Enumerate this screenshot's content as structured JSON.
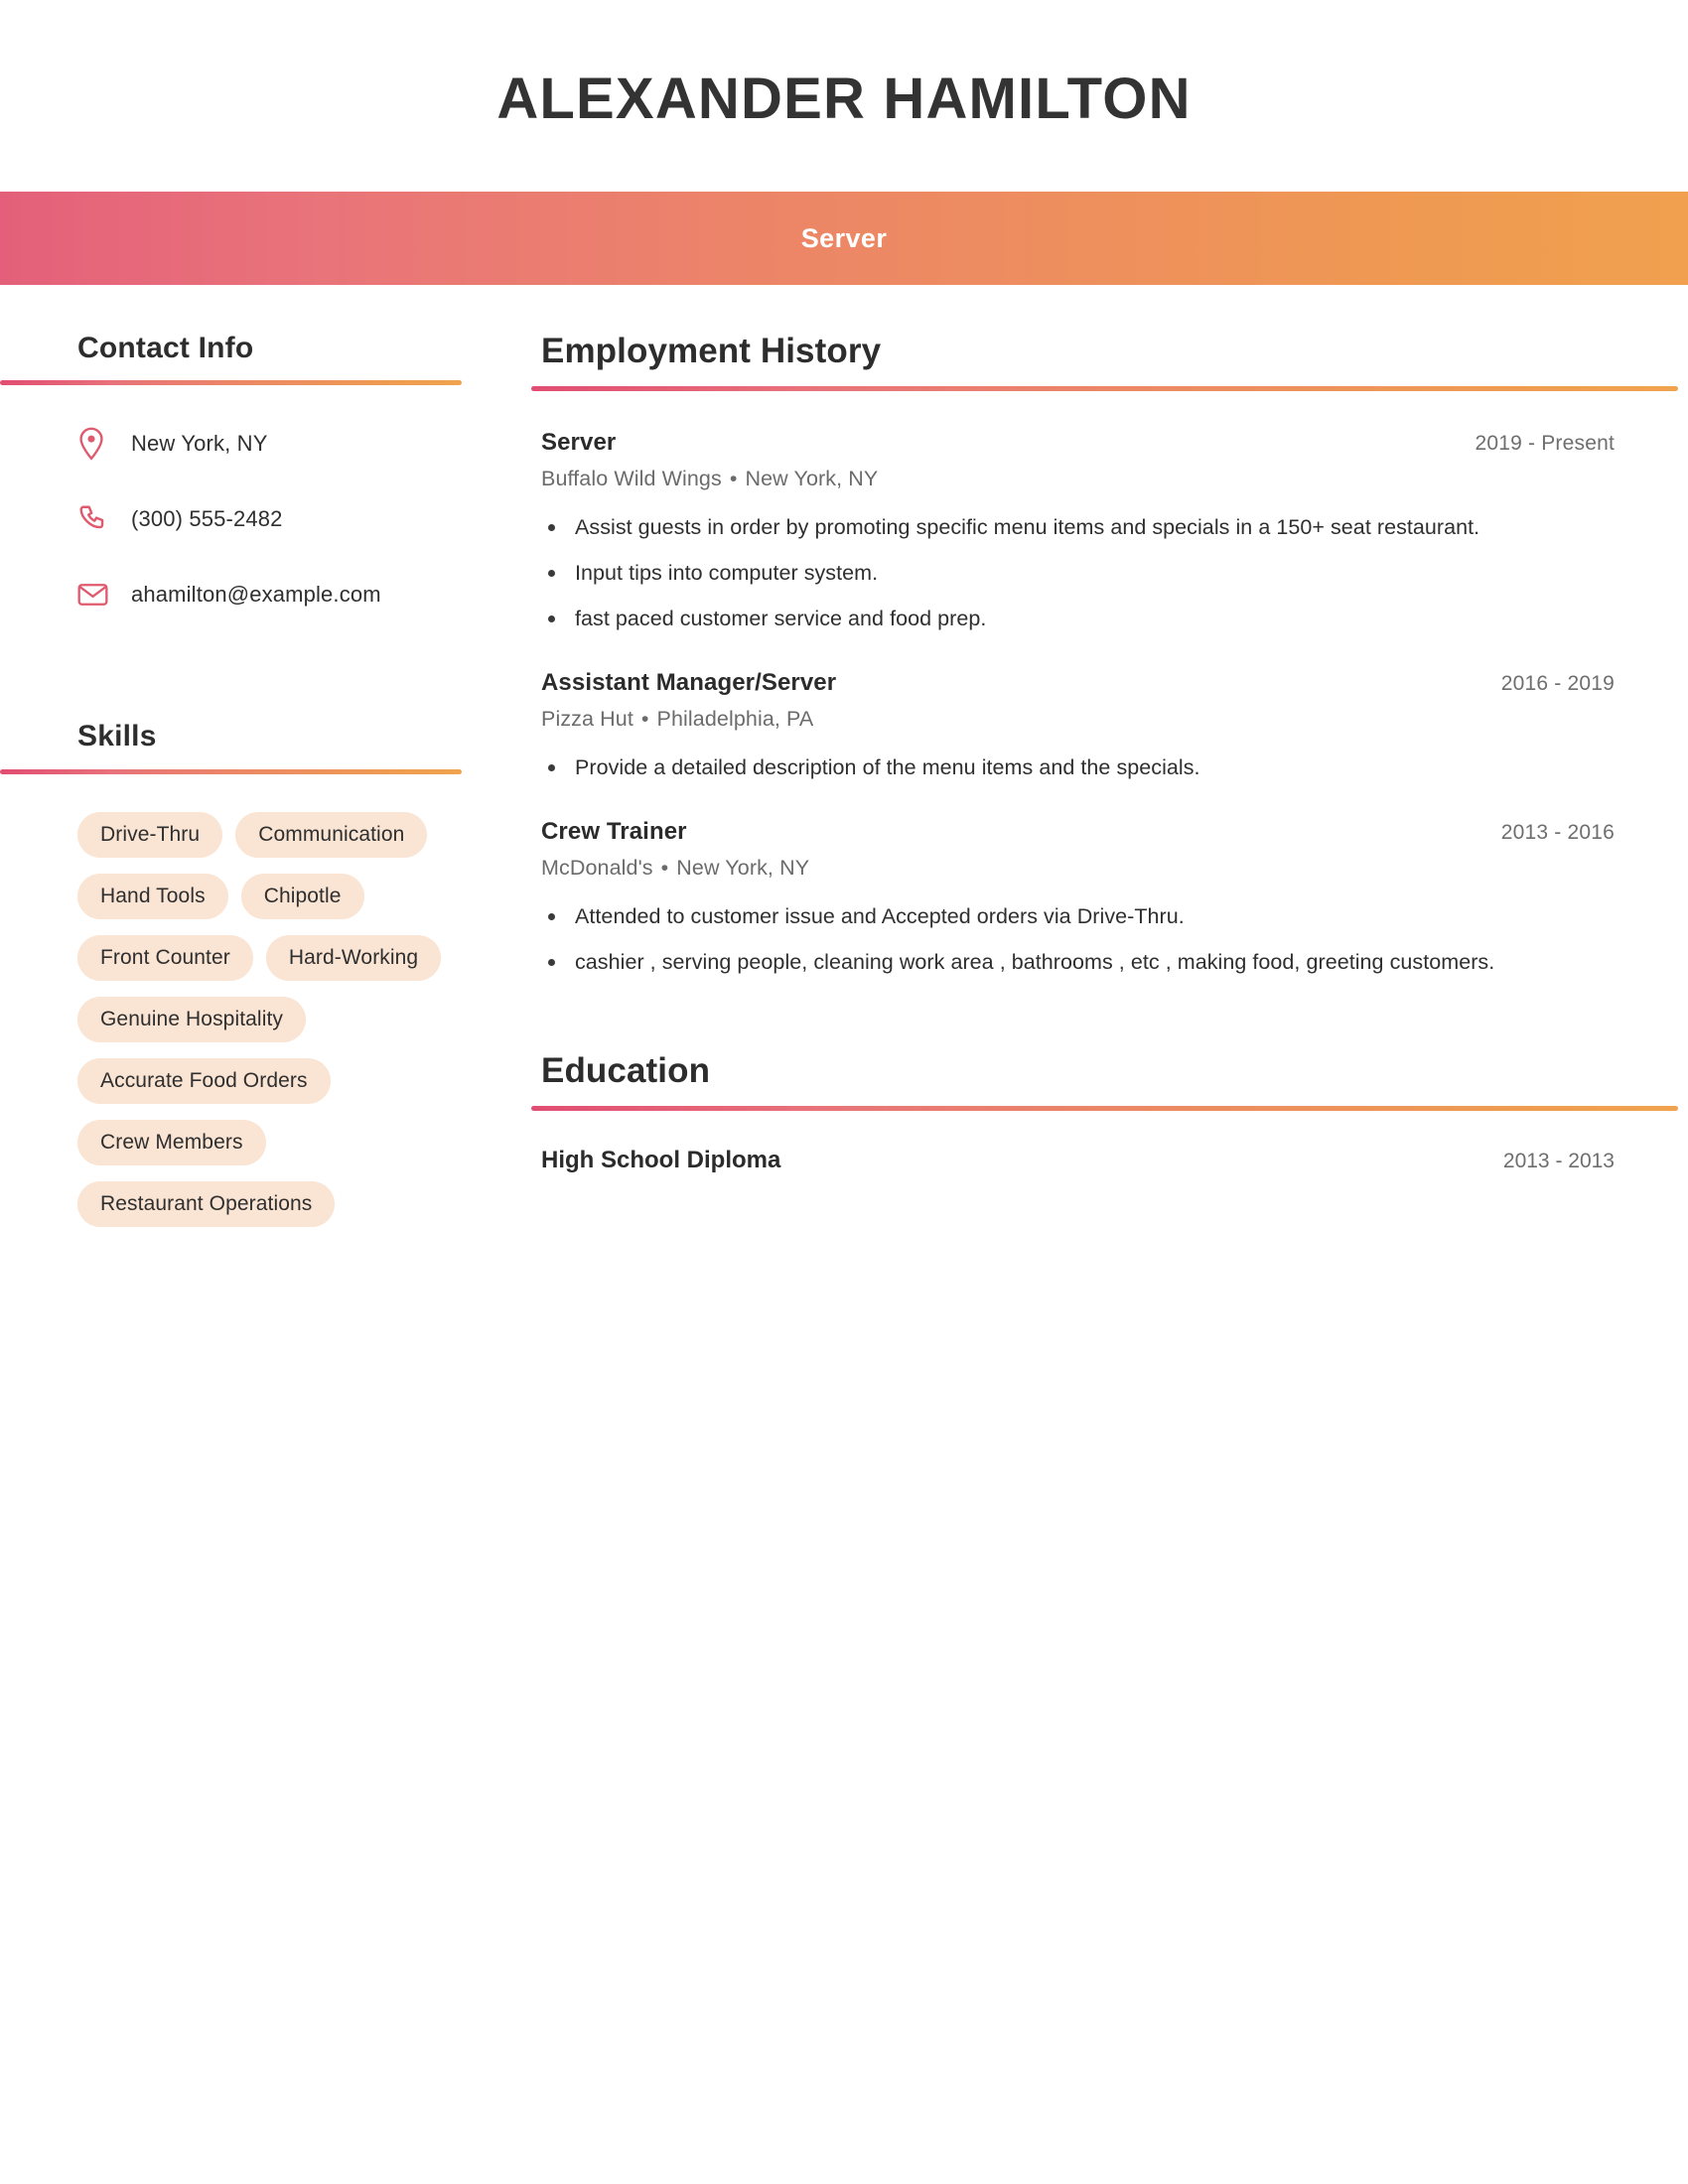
{
  "header": {
    "name": "ALEXANDER HAMILTON",
    "title": "Server"
  },
  "colors": {
    "gradient_start": "#e4607a",
    "gradient_end": "#f0a04f",
    "icon_pink": "#e05a6e",
    "skill_pill_bg": "#fae4d3",
    "heading_text": "#2d2d2d",
    "muted_text": "#6e6e6e"
  },
  "sidebar": {
    "contact": {
      "heading": "Contact Info",
      "items": [
        {
          "icon": "location-pin-icon",
          "value": "New York, NY"
        },
        {
          "icon": "phone-icon",
          "value": "(300) 555-2482"
        },
        {
          "icon": "envelope-icon",
          "value": "ahamilton@example.com"
        }
      ]
    },
    "skills": {
      "heading": "Skills",
      "items": [
        "Drive-Thru",
        "Communication",
        "Hand Tools",
        "Chipotle",
        "Front Counter",
        "Hard-Working",
        "Genuine Hospitality",
        "Accurate Food Orders",
        "Crew Members",
        "Restaurant Operations"
      ]
    }
  },
  "main": {
    "employment": {
      "heading": "Employment History",
      "entries": [
        {
          "role": "Server",
          "dates": "2019 - Present",
          "company": "Buffalo Wild Wings",
          "separator": "•",
          "location": "New York, NY",
          "bullets": [
            "Assist guests in order by promoting specific menu items and specials in a 150+ seat restaurant.",
            "Input tips into computer system.",
            "fast paced customer service and food prep."
          ]
        },
        {
          "role": "Assistant Manager/Server",
          "dates": "2016 - 2019",
          "company": "Pizza Hut",
          "separator": "•",
          "location": "Philadelphia, PA",
          "bullets": [
            "Provide a detailed description of the menu items and the specials."
          ]
        },
        {
          "role": "Crew Trainer",
          "dates": "2013 - 2016",
          "company": "McDonald's",
          "separator": "•",
          "location": "New York, NY",
          "bullets": [
            "Attended to customer issue and Accepted orders via Drive-Thru.",
            "cashier , serving people, cleaning work area , bathrooms , etc , making food, greeting customers."
          ]
        }
      ]
    },
    "education": {
      "heading": "Education",
      "entries": [
        {
          "degree": "High School Diploma",
          "dates": "2013 - 2013"
        }
      ]
    }
  }
}
